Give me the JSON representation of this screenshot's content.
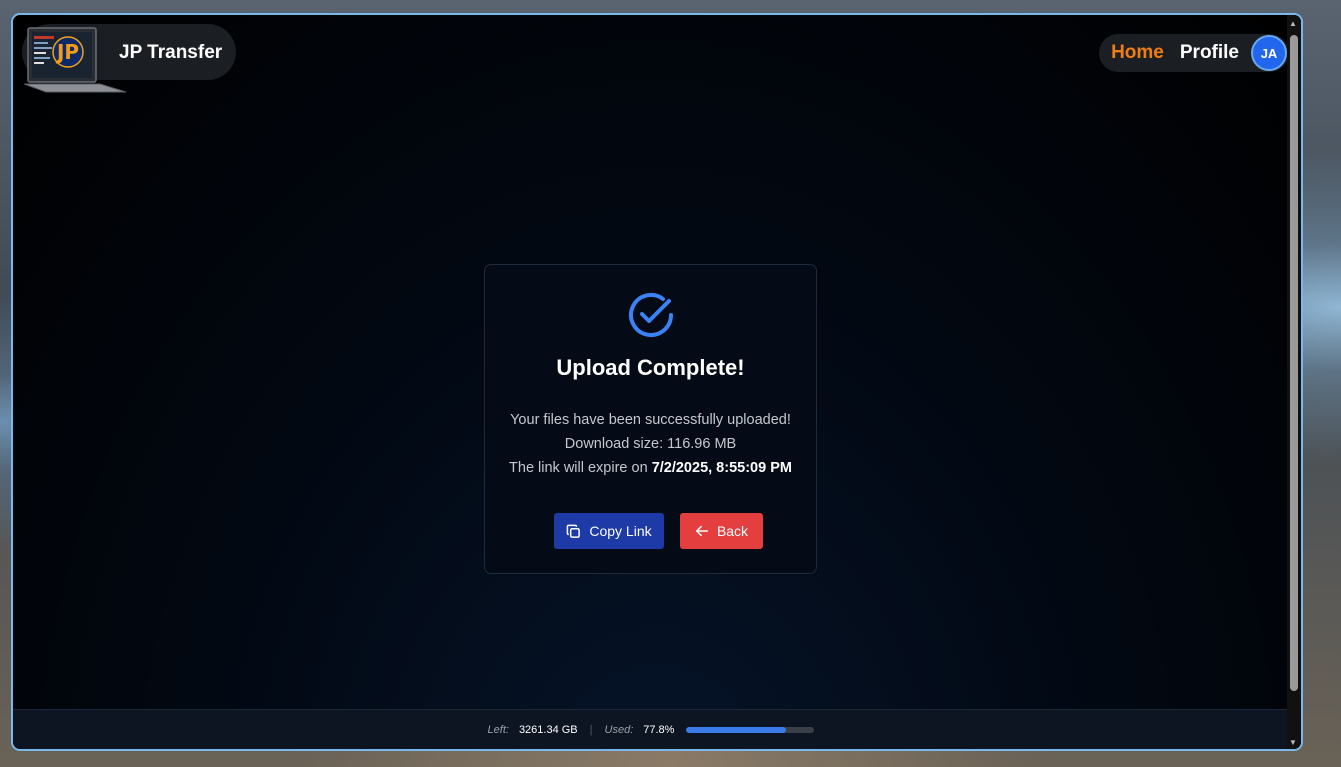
{
  "app": {
    "name": "JP Transfer",
    "logo_text": "JP"
  },
  "nav": {
    "home": "Home",
    "profile": "Profile",
    "avatar_initials": "JA"
  },
  "card": {
    "title": "Upload Complete!",
    "message": "Your files have been successfully uploaded!",
    "download_size": "Download size: 116.96 MB",
    "expire_prefix": "The link will expire on ",
    "expire_date": "7/2/2025, 8:55:09 PM",
    "copy_label": "Copy Link",
    "back_label": "Back"
  },
  "footer": {
    "left_label": "Left:",
    "left_value": "3261.34 GB",
    "separator": "|",
    "used_label": "Used:",
    "used_value": "77.8%",
    "used_fraction": 0.778
  },
  "colors": {
    "accent": "#f07d11",
    "primary": "#1d3aa6",
    "danger": "#e53e3e",
    "check": "#3b82f6"
  }
}
